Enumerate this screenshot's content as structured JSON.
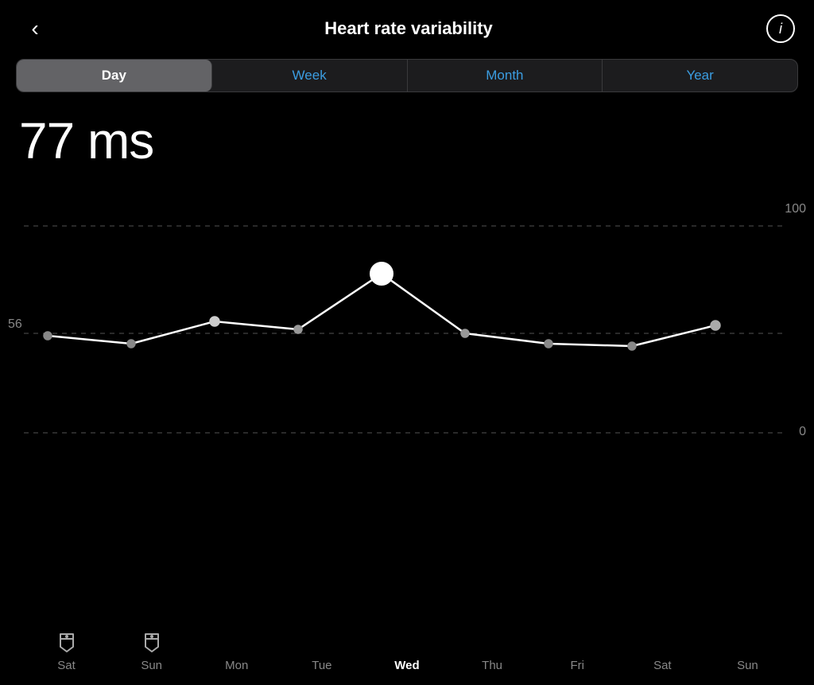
{
  "header": {
    "back_label": "‹",
    "title": "Heart rate variability",
    "info_label": "i"
  },
  "tabs": {
    "items": [
      {
        "label": "Day",
        "active": true
      },
      {
        "label": "Week",
        "active": false
      },
      {
        "label": "Month",
        "active": false
      },
      {
        "label": "Year",
        "active": false
      }
    ]
  },
  "value": {
    "display": "77 ms"
  },
  "chart": {
    "y_labels": {
      "top": "100",
      "mid": "56",
      "bottom": "0"
    },
    "x_labels": [
      {
        "label": "Sat",
        "active": false,
        "tag": true
      },
      {
        "label": "Sun",
        "active": false,
        "tag": true
      },
      {
        "label": "Mon",
        "active": false,
        "tag": false
      },
      {
        "label": "Tue",
        "active": false,
        "tag": false
      },
      {
        "label": "Wed",
        "active": true,
        "tag": false
      },
      {
        "label": "Thu",
        "active": false,
        "tag": false
      },
      {
        "label": "Fri",
        "active": false,
        "tag": false
      },
      {
        "label": "Sat",
        "active": false,
        "tag": false
      },
      {
        "label": "Sun",
        "active": false,
        "tag": false
      }
    ]
  }
}
